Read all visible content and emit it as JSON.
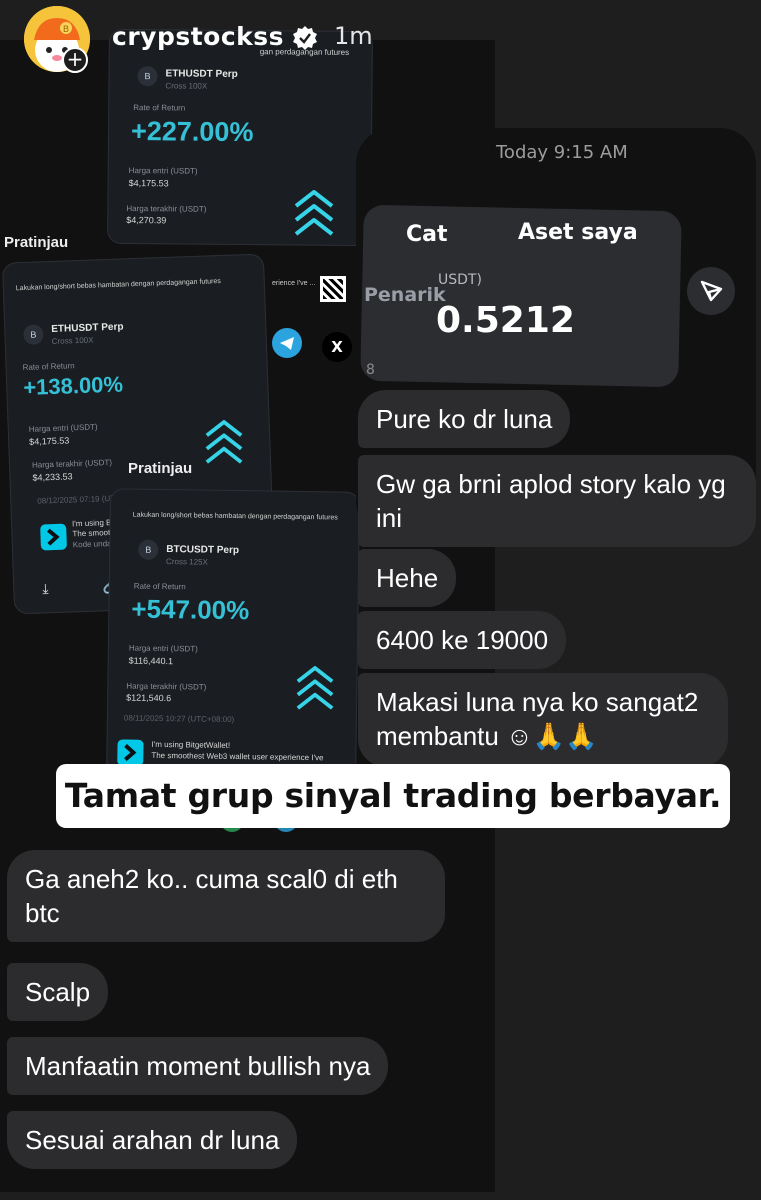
{
  "header": {
    "username": "crypstockss",
    "time_ago": "1m"
  },
  "cards": {
    "card1": {
      "headline": "gan perdagangan futures",
      "pair": "ETHUSDT Perp",
      "cross": "Cross 100X",
      "rate_label": "Rate of Return",
      "roi": "+227.00%",
      "entry_label": "Harga entri (USDT)",
      "entry_value": "$4,175.53",
      "last_label": "Harga terakhir (USDT)",
      "last_value": "$4,270.39"
    },
    "card2": {
      "preview_title": "Pratinjau",
      "headline": "Lakukan long/short bebas hambatan dengan perdagangan futures",
      "pair": "ETHUSDT Perp",
      "cross": "Cross 100X",
      "rate_label": "Rate of Return",
      "roi": "+138.00%",
      "entry_label": "Harga entri (USDT)",
      "entry_value": "$4,175.53",
      "last_label": "Harga terakhir (USDT)",
      "last_value": "$4,233.53",
      "date": "08/12/2025 07:19 (UTC+",
      "promo_line1": "I'm using Bitge",
      "promo_line2": "The smoot",
      "promo_line3": "Kode undang",
      "experience_text": "erience I've ..."
    },
    "card3": {
      "preview_title": "Pratinjau",
      "headline": "Lakukan long/short bebas hambatan dengan perdagangan futures",
      "pair": "BTCUSDT Perp",
      "cross": "Cross 125X",
      "rate_label": "Rate of Return",
      "roi": "+547.00%",
      "entry_label": "Harga entri (USDT)",
      "entry_value": "$116,440.1",
      "last_label": "Harga terakhir (USDT)",
      "last_value": "$121,540.6",
      "date": "08/11/2025 10:27 (UTC+08:00)",
      "promo_line1": "I'm using BitgetWallet!",
      "promo_line2": "The smoothest Web3 wallet user experience I've"
    }
  },
  "chat": {
    "timestamp": "Today 9:15 AM",
    "asset_tab_left": "Cat",
    "asset_tab_right": "Aset saya",
    "asset_row_label": "Penarik",
    "asset_unit": "USDT)",
    "asset_value": "0.5212",
    "asset_fragment": "8",
    "messages_right": [
      "Pure ko dr luna",
      "Gw ga brni aplod story kalo yg ini",
      "Hehe",
      "6400 ke 19000",
      "Makasi luna nya ko sangat2 membantu ☺🙏🙏"
    ],
    "messages_left": [
      "Ga aneh2 ko.. cuma scal0 di eth btc",
      "Scalp",
      "Manfaatin moment bullish nya",
      "Sesuai arahan dr luna"
    ]
  },
  "caption": "Tamat grup sinyal trading berbayar.",
  "colors": {
    "roi": "#35c0d6",
    "bubble": "#2c2c2e",
    "brand_bitget": "#00c8e6"
  }
}
